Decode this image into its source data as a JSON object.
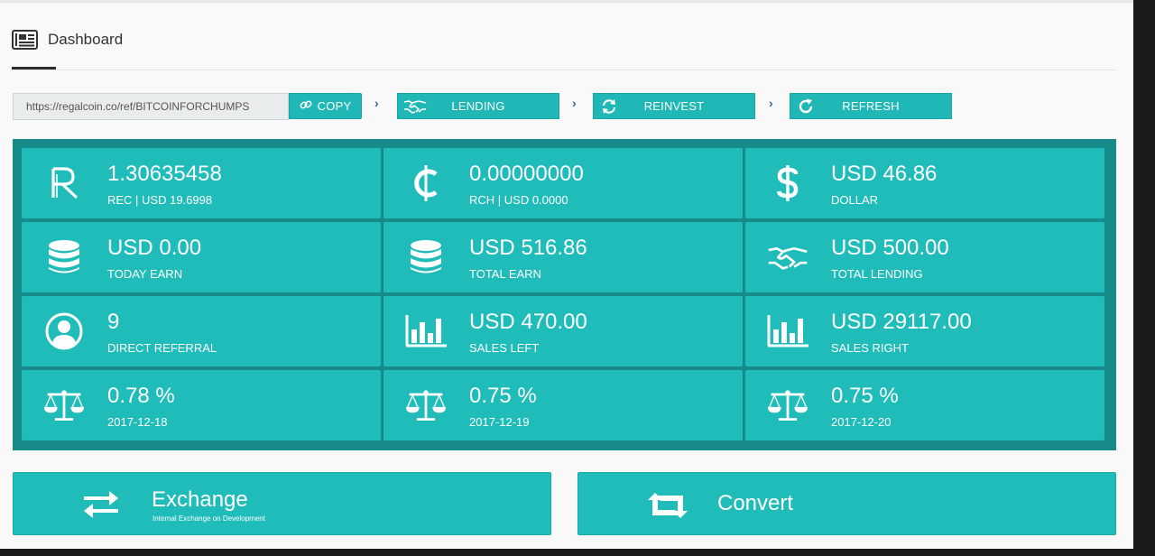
{
  "header": {
    "title": "Dashboard",
    "icon": "newspaper-icon"
  },
  "referral": {
    "url": "https://regalcoin.co/ref/BITCOINFORCHUMPS"
  },
  "toolbar": {
    "copy_label": "COPY",
    "lending_label": "LENDING",
    "reinvest_label": "REINVEST",
    "refresh_label": "REFRESH",
    "chevron": "›"
  },
  "stats": [
    {
      "value": "1.30635458",
      "label": "REC | USD 19.6998",
      "icon": "regalcoin-icon"
    },
    {
      "value": "0.00000000",
      "label": "RCH | USD 0.0000",
      "icon": "cedi-icon"
    },
    {
      "value": "USD 46.86",
      "label": "DOLLAR",
      "icon": "dollar-icon"
    },
    {
      "value": "USD 0.00",
      "label": "TODAY EARN",
      "icon": "database-icon"
    },
    {
      "value": "USD 516.86",
      "label": "TOTAL EARN",
      "icon": "database-icon"
    },
    {
      "value": "USD 500.00",
      "label": "TOTAL LENDING",
      "icon": "handshake-icon"
    },
    {
      "value": "9",
      "label": "DIRECT REFERRAL",
      "icon": "user-circle-icon"
    },
    {
      "value": "USD 470.00",
      "label": "SALES LEFT",
      "icon": "bar-chart-icon"
    },
    {
      "value": "USD 29117.00",
      "label": "SALES RIGHT",
      "icon": "bar-chart-icon"
    },
    {
      "value": "0.78 %",
      "label": "2017-12-18",
      "icon": "balance-scale-icon"
    },
    {
      "value": "0.75 %",
      "label": "2017-12-19",
      "icon": "balance-scale-icon"
    },
    {
      "value": "0.75 %",
      "label": "2017-12-20",
      "icon": "balance-scale-icon"
    }
  ],
  "exchange": {
    "title": "Exchange",
    "subtitle": "Internal Exchange on Development"
  },
  "convert": {
    "title": "Convert"
  },
  "colors": {
    "accent": "#20bcba",
    "panel": "#178b89",
    "chevron": "#2b6f8f"
  }
}
